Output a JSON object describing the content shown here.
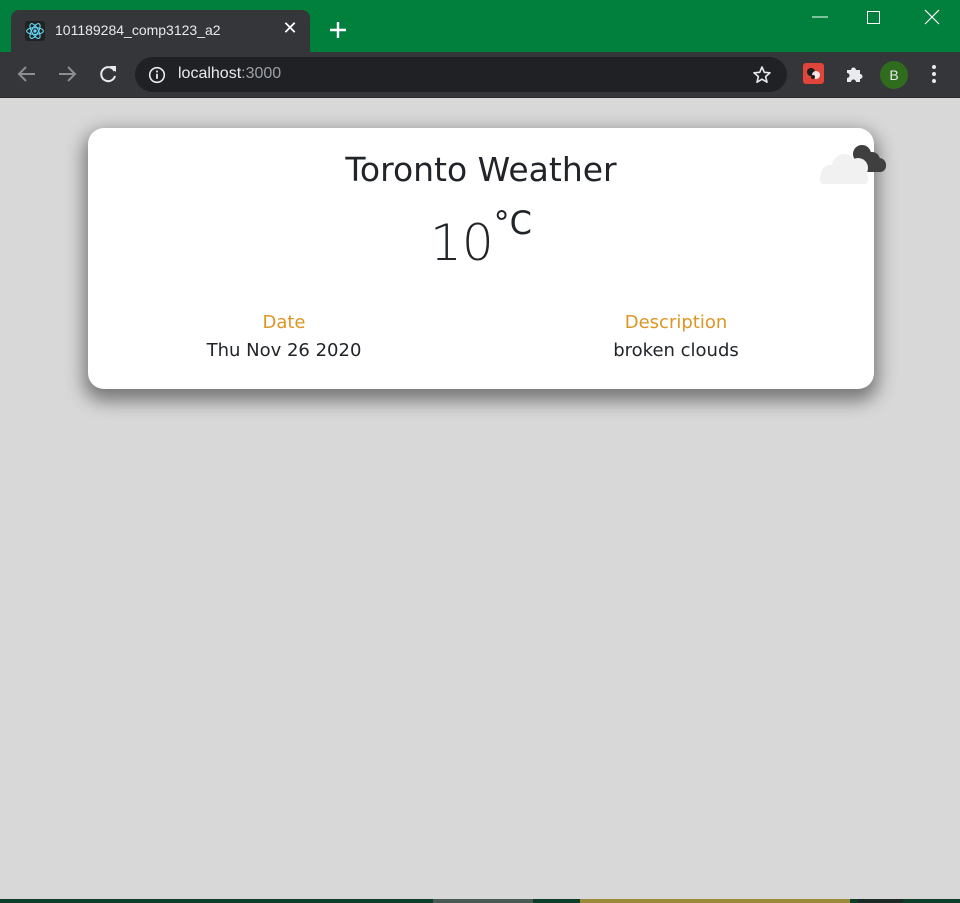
{
  "browser": {
    "tab_title": "101189284_comp3123_a2",
    "tab_close": "✕",
    "url_host": "localhost",
    "url_port": ":3000",
    "profile_initial": "B",
    "frame_color": "#01803d"
  },
  "weather": {
    "title": "Toronto Weather",
    "temperature": "10",
    "unit": "°C",
    "date_label": "Date",
    "date_value": "Thu Nov 26 2020",
    "description_label": "Description",
    "description_value": "broken clouds",
    "icon": "broken-clouds-icon",
    "label_color": "#dd9524"
  }
}
